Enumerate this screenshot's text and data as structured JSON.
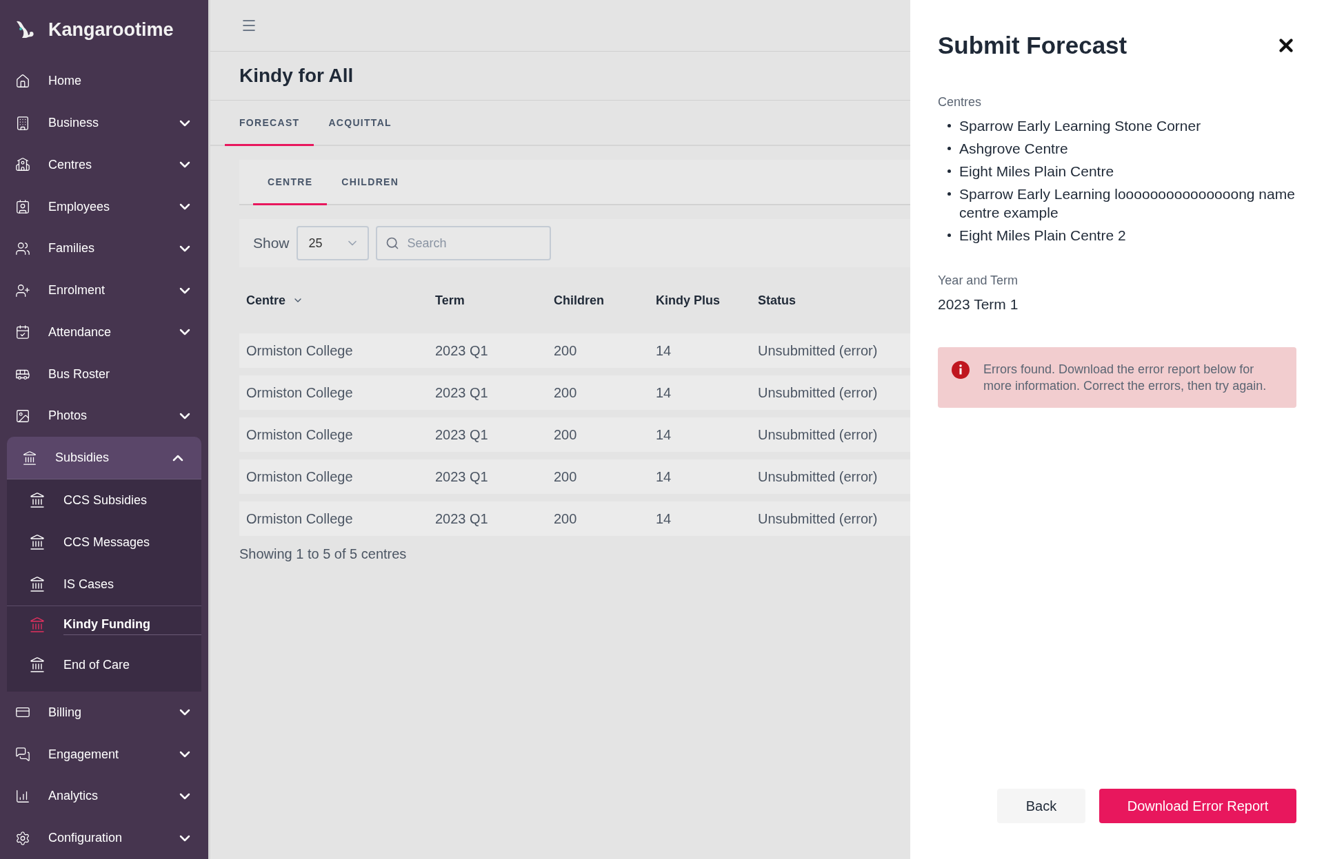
{
  "brand": {
    "name": "Kangarootime"
  },
  "sidebar": {
    "items": [
      {
        "label": "Home",
        "expandable": false,
        "expanded": false
      },
      {
        "label": "Business",
        "expandable": true,
        "expanded": false
      },
      {
        "label": "Centres",
        "expandable": true,
        "expanded": false
      },
      {
        "label": "Employees",
        "expandable": true,
        "expanded": false
      },
      {
        "label": "Families",
        "expandable": true,
        "expanded": false
      },
      {
        "label": "Enrolment",
        "expandable": true,
        "expanded": false
      },
      {
        "label": "Attendance",
        "expandable": true,
        "expanded": false
      },
      {
        "label": "Bus Roster",
        "expandable": false,
        "expanded": false
      },
      {
        "label": "Photos",
        "expandable": true,
        "expanded": false
      },
      {
        "label": "Subsidies",
        "expandable": true,
        "expanded": true,
        "children": [
          {
            "label": "CCS Subsidies",
            "selected": false
          },
          {
            "label": "CCS Messages",
            "selected": false
          },
          {
            "label": "IS Cases",
            "selected": false
          },
          {
            "label": "Kindy Funding",
            "selected": true
          },
          {
            "label": "End of Care",
            "selected": false
          }
        ]
      },
      {
        "label": "Billing",
        "expandable": true,
        "expanded": false
      },
      {
        "label": "Engagement",
        "expandable": true,
        "expanded": false
      },
      {
        "label": "Analytics",
        "expandable": true,
        "expanded": false
      },
      {
        "label": "Configuration",
        "expandable": true,
        "expanded": false
      }
    ]
  },
  "page": {
    "title": "Kindy for All",
    "tabs": [
      {
        "label": "FORECAST",
        "selected": true
      },
      {
        "label": "ACQUITTAL",
        "selected": false
      }
    ],
    "subtabs": [
      {
        "label": "CENTRE",
        "selected": true
      },
      {
        "label": "CHILDREN",
        "selected": false
      }
    ],
    "toolbar": {
      "show_label": "Show",
      "page_size": "25",
      "search_placeholder": "Search"
    },
    "table": {
      "columns": [
        {
          "label": "Centre",
          "sortable": true
        },
        {
          "label": "Term"
        },
        {
          "label": "Children"
        },
        {
          "label": "Kindy Plus"
        },
        {
          "label": "Status"
        }
      ],
      "rows": [
        [
          "Ormiston College",
          "2023 Q1",
          "200",
          "14",
          "Unsubmitted (error)"
        ],
        [
          "Ormiston College",
          "2023 Q1",
          "200",
          "14",
          "Unsubmitted (error)"
        ],
        [
          "Ormiston College",
          "2023 Q1",
          "200",
          "14",
          "Unsubmitted (error)"
        ],
        [
          "Ormiston College",
          "2023 Q1",
          "200",
          "14",
          "Unsubmitted (error)"
        ],
        [
          "Ormiston College",
          "2023 Q1",
          "200",
          "14",
          "Unsubmitted (error)"
        ]
      ]
    },
    "footer": "Showing 1 to 5 of 5 centres"
  },
  "panel": {
    "title": "Submit Forecast",
    "centres_label": "Centres",
    "centres": [
      "Sparrow Early Learning Stone Corner",
      "Ashgrove Centre",
      "Eight Miles Plain Centre",
      "Sparrow Early Learning looooooooooooooong name centre example",
      "Eight Miles Plain Centre 2"
    ],
    "term_label": "Year and Term",
    "term_value": "2023 Term 1",
    "alert": "Errors found. Download the error report below for more information. Correct the errors, then try again.",
    "buttons": {
      "back": "Back",
      "download": "Download Error Report"
    }
  }
}
